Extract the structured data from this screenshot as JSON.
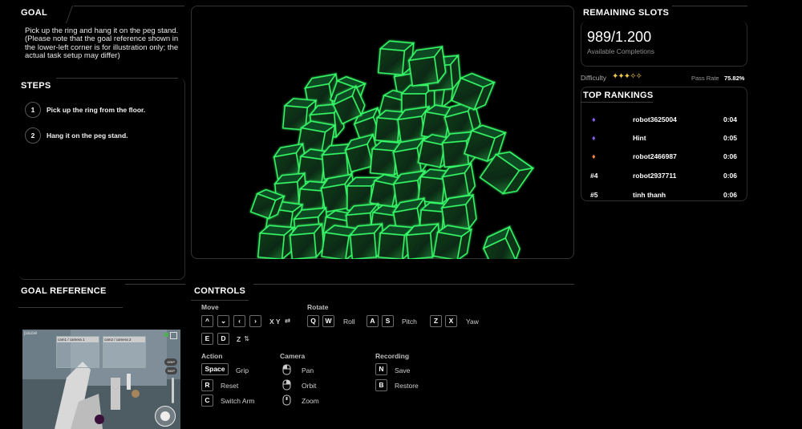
{
  "goal": {
    "heading": "GOAL",
    "text": "Pick up the ring and hang it on the peg stand. (Please note that the goal reference shown in the lower-left corner is for illustration only; the actual task setup may differ)"
  },
  "steps": {
    "heading": "STEPS",
    "items": [
      {
        "num": "1",
        "label": "Pick up the ring from the floor."
      },
      {
        "num": "2",
        "label": "Hang it on the peg stand."
      }
    ]
  },
  "goal_reference": {
    "heading": "GOAL REFERENCE",
    "pause_label": "pause",
    "cam1_label": "cam1 / camera 1",
    "cam2_label": "cam2 / camera 2",
    "side_btn1": "GRIP",
    "side_btn2": "SKIP"
  },
  "controls": {
    "heading": "CONTROLS",
    "move": {
      "title": "Move",
      "xy_label": "X Y",
      "z_label": "Z",
      "keys": [
        "E",
        "D"
      ]
    },
    "rotate": {
      "title": "Rotate",
      "roll_keys": [
        "Q",
        "W"
      ],
      "roll_label": "Roll",
      "pitch_keys": [
        "A",
        "S"
      ],
      "pitch_label": "Pitch",
      "yaw_keys": [
        "Z",
        "X"
      ],
      "yaw_label": "Yaw"
    },
    "action": {
      "title": "Action",
      "items": [
        {
          "key": "Space",
          "label": "Grip"
        },
        {
          "key": "R",
          "label": "Reset"
        },
        {
          "key": "C",
          "label": "Switch Arm"
        }
      ]
    },
    "camera": {
      "title": "Camera",
      "items": [
        {
          "icon": "mouse-left-icon",
          "label": "Pan"
        },
        {
          "icon": "mouse-right-icon",
          "label": "Orbit"
        },
        {
          "icon": "mouse-scroll-icon",
          "label": "Zoom"
        }
      ]
    },
    "recording": {
      "title": "Recording",
      "items": [
        {
          "key": "N",
          "label": "Save"
        },
        {
          "key": "B",
          "label": "Restore"
        }
      ]
    }
  },
  "remaining_slots": {
    "heading": "REMAINING SLOTS",
    "value": "989/1.200",
    "caption": "Available Completions",
    "difficulty_label": "Difficulty",
    "difficulty_stars": "✦✦✦✧✧",
    "difficulty_level": 3,
    "difficulty_max": 5,
    "pass_rate_label": "Pass Rate",
    "pass_rate_value": "75.82%"
  },
  "rankings": {
    "heading": "TOP RANKINGS",
    "rows": [
      {
        "rank": "",
        "icon": "purple-medal-icon",
        "name": "robot3625004",
        "time": "0:04"
      },
      {
        "rank": "",
        "icon": "purple-medal-icon",
        "name": "Hint",
        "time": "0:05"
      },
      {
        "rank": "",
        "icon": "orange-medal-icon",
        "name": "robot2466987",
        "time": "0:06"
      },
      {
        "rank": "#4",
        "icon": "",
        "name": "robot2937711",
        "time": "0:06"
      },
      {
        "rank": "#5",
        "icon": "",
        "name": "tinh thanh",
        "time": "0:06"
      }
    ]
  },
  "colors": {
    "accent_green": "#39ff6a",
    "gold": "#f2c94c",
    "purple": "#8a5cf5",
    "orange": "#f08a3c"
  }
}
